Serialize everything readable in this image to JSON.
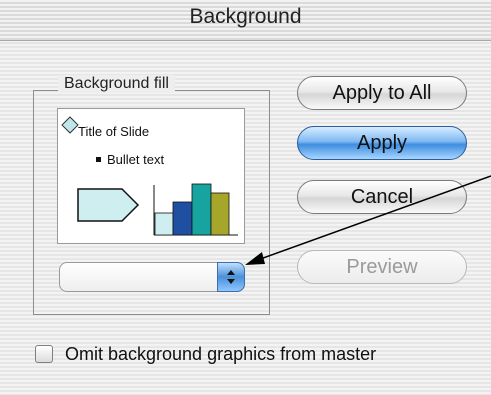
{
  "window": {
    "title": "Background"
  },
  "background_fill": {
    "label": "Background fill",
    "preview": {
      "title_text": "Title of Slide",
      "bullet_text": "Bullet text"
    },
    "popup": {
      "value": ""
    }
  },
  "buttons": {
    "apply_to_all": "Apply to All",
    "apply": "Apply",
    "cancel": "Cancel",
    "preview": "Preview"
  },
  "options": {
    "omit_background_graphics": {
      "label": "Omit background graphics from master",
      "checked": false
    }
  },
  "colors": {
    "accent_blue": "#4a90d9",
    "preview_light": "#cfeef0",
    "preview_dark_blue": "#1f4fa0",
    "preview_teal": "#17a3a0",
    "preview_olive": "#a5a62a"
  },
  "icons": [
    "diamond-bullet-icon",
    "square-bullet-icon",
    "arrow-shape-icon",
    "bar-chart-icon",
    "popup-arrows-icon",
    "pointer-arrow-icon",
    "checkbox-icon"
  ]
}
